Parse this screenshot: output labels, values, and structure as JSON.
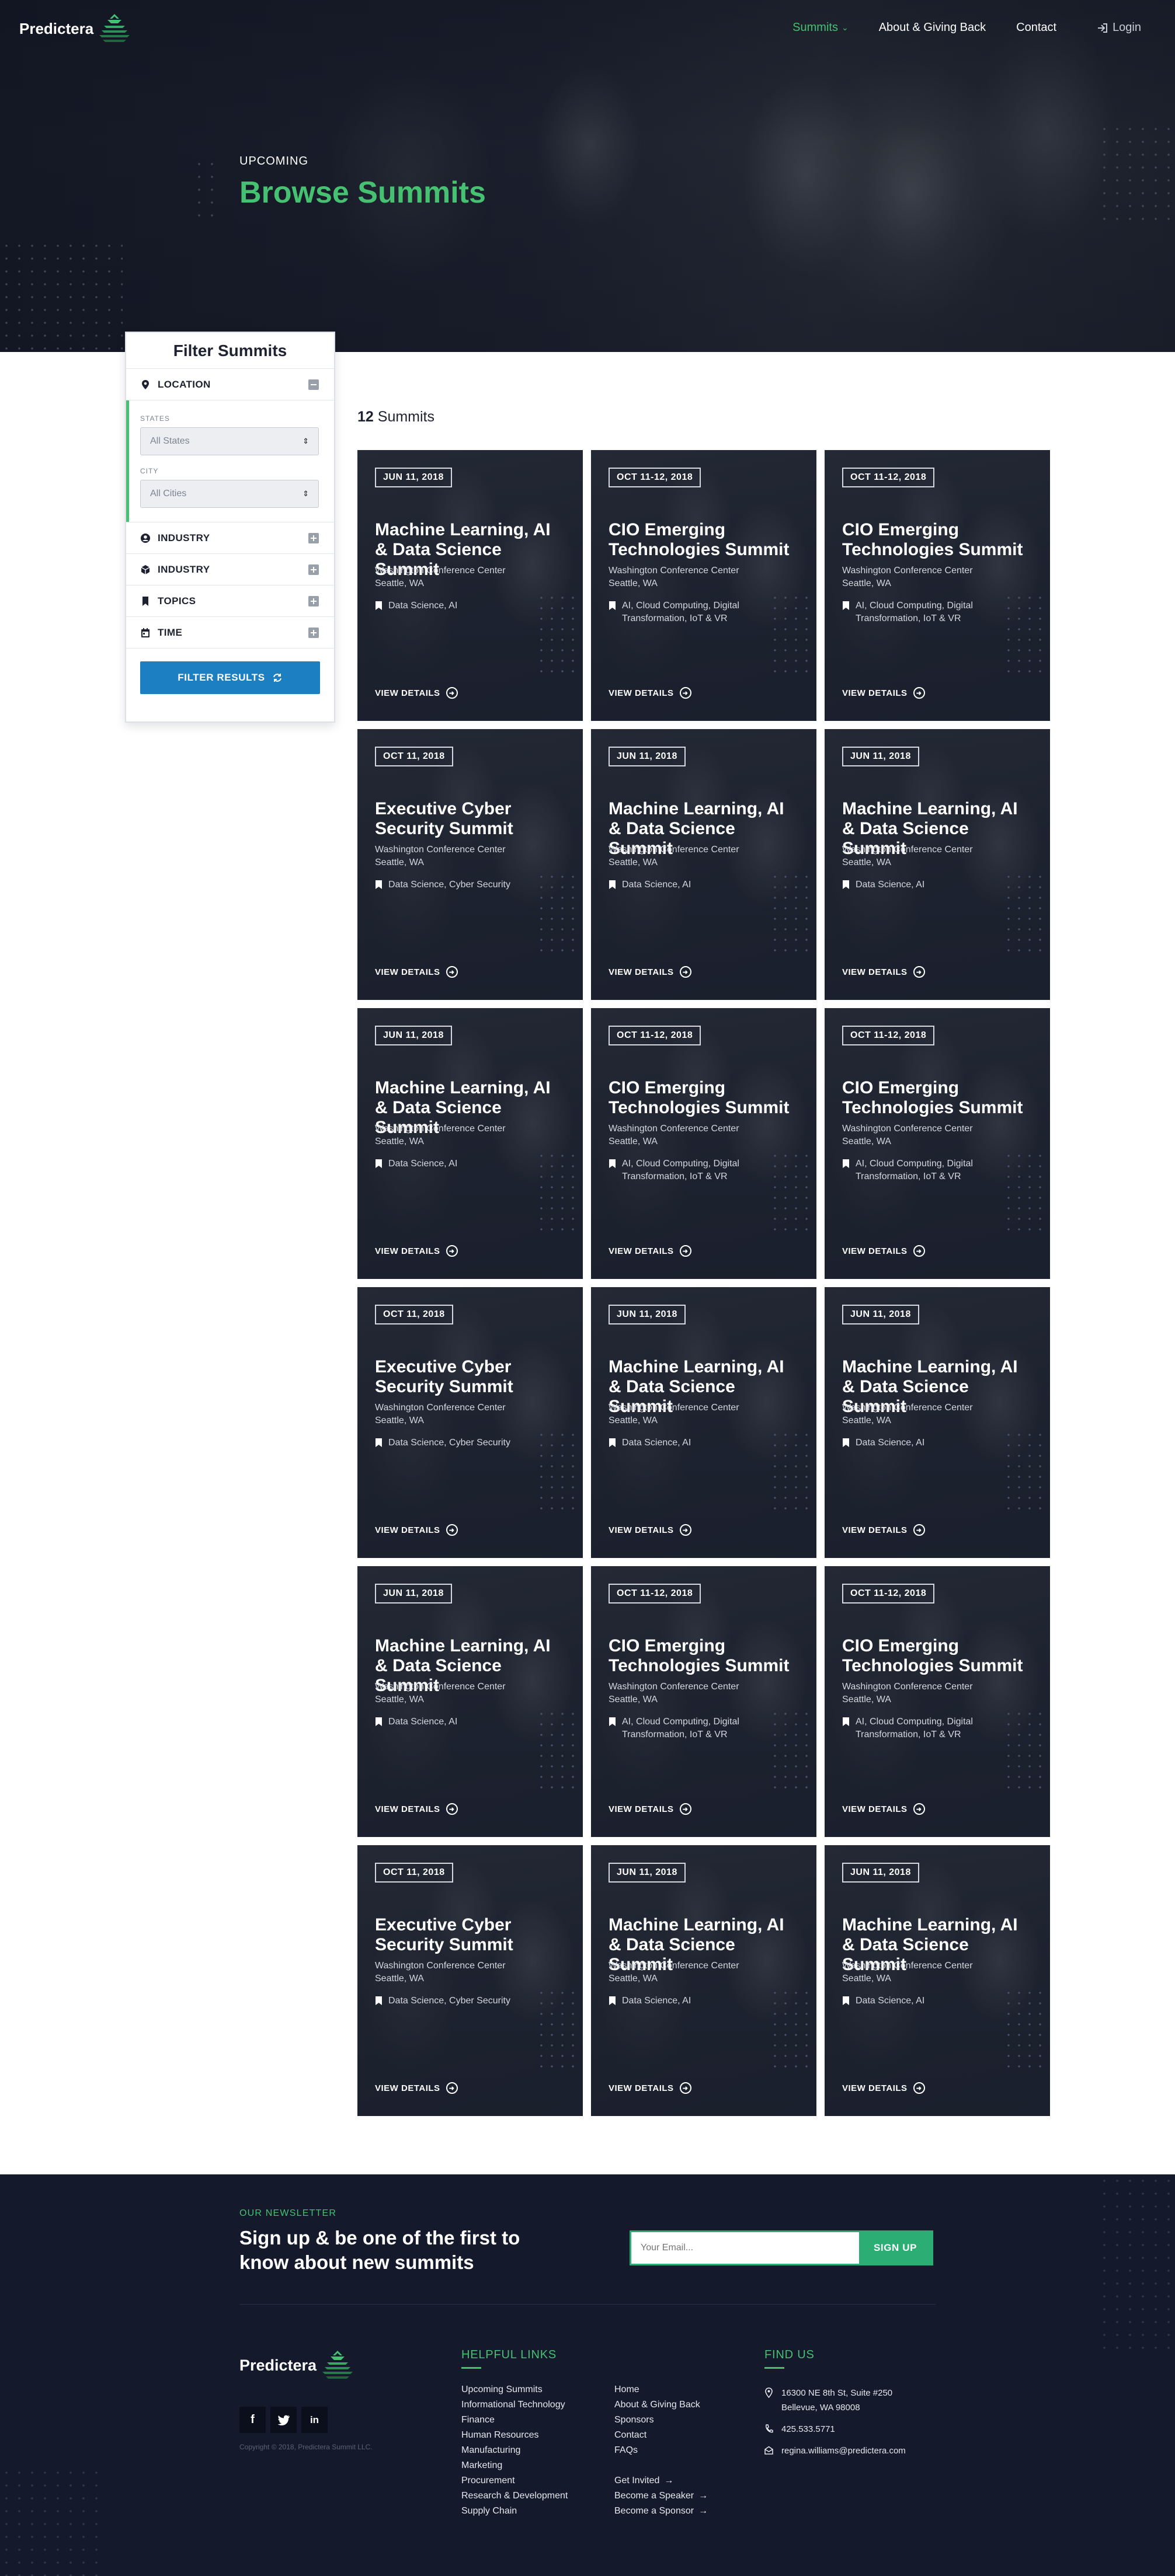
{
  "brand": {
    "name": "Predictera",
    "accent": "#45c171",
    "dark": "#1a1e2b"
  },
  "nav": {
    "items": [
      {
        "label": "Summits",
        "active": true,
        "icon": "chevron-down-icon"
      },
      {
        "label": "About & Giving Back"
      },
      {
        "label": "Contact"
      }
    ],
    "login": "Login"
  },
  "hero": {
    "eyebrow": "UPCOMING",
    "title": "Browse Summits"
  },
  "filter": {
    "title": "Filter Summits",
    "location": {
      "label": "LOCATION",
      "states_label": "STATES",
      "states_value": "All States",
      "city_label": "CITY",
      "city_value": "All Cities"
    },
    "sections": [
      {
        "label": "INDUSTRY",
        "icon": "user-circle-icon"
      },
      {
        "label": "INDUSTRY",
        "icon": "cube-icon"
      },
      {
        "label": "TOPICS",
        "icon": "bookmark-icon"
      },
      {
        "label": "TIME",
        "icon": "calendar-icon"
      }
    ],
    "button": "FILTER RESULTS"
  },
  "results": {
    "count": "12",
    "label": "Summits"
  },
  "cards": [
    {
      "date": "JUN 11, 2018",
      "title": "Machine Learning, AI & Data Science Summit",
      "venue": "Washington Conference Center",
      "city": "Seattle, WA",
      "tags": "Data Science, AI",
      "cta": "VIEW DETAILS"
    },
    {
      "date": "OCT 11-12, 2018",
      "title": "CIO Emerging Technologies Summit",
      "venue": "Washington Conference Center",
      "city": "Seattle, WA",
      "tags": "AI, Cloud Computing, Digital Transformation, IoT & VR",
      "cta": "VIEW DETAILS"
    },
    {
      "date": "OCT 11-12, 2018",
      "title": "CIO Emerging Technologies Summit",
      "venue": "Washington Conference Center",
      "city": "Seattle, WA",
      "tags": "AI, Cloud Computing, Digital Transformation, IoT & VR",
      "cta": "VIEW DETAILS"
    },
    {
      "date": "OCT 11, 2018",
      "title": "Executive Cyber Security Summit",
      "venue": "Washington Conference Center",
      "city": "Seattle, WA",
      "tags": "Data Science, Cyber Security",
      "cta": "VIEW DETAILS"
    },
    {
      "date": "JUN 11, 2018",
      "title": "Machine Learning, AI & Data Science Summit",
      "venue": "Washington Conference Center",
      "city": "Seattle, WA",
      "tags": "Data Science, AI",
      "cta": "VIEW DETAILS"
    },
    {
      "date": "JUN 11, 2018",
      "title": "Machine Learning, AI & Data Science Summit",
      "venue": "Washington Conference Center",
      "city": "Seattle, WA",
      "tags": "Data Science, AI",
      "cta": "VIEW DETAILS"
    },
    {
      "date": "JUN 11, 2018",
      "title": "Machine Learning, AI & Data Science Summit",
      "venue": "Washington Conference Center",
      "city": "Seattle, WA",
      "tags": "Data Science, AI",
      "cta": "VIEW DETAILS"
    },
    {
      "date": "OCT 11-12, 2018",
      "title": "CIO Emerging Technologies Summit",
      "venue": "Washington Conference Center",
      "city": "Seattle, WA",
      "tags": "AI, Cloud Computing, Digital Transformation, IoT & VR",
      "cta": "VIEW DETAILS"
    },
    {
      "date": "OCT 11-12, 2018",
      "title": "CIO Emerging Technologies Summit",
      "venue": "Washington Conference Center",
      "city": "Seattle, WA",
      "tags": "AI, Cloud Computing, Digital Transformation, IoT & VR",
      "cta": "VIEW DETAILS"
    },
    {
      "date": "OCT 11, 2018",
      "title": "Executive Cyber Security Summit",
      "venue": "Washington Conference Center",
      "city": "Seattle, WA",
      "tags": "Data Science, Cyber Security",
      "cta": "VIEW DETAILS"
    },
    {
      "date": "JUN 11, 2018",
      "title": "Machine Learning, AI & Data Science Summit",
      "venue": "Washington Conference Center",
      "city": "Seattle, WA",
      "tags": "Data Science, AI",
      "cta": "VIEW DETAILS"
    },
    {
      "date": "JUN 11, 2018",
      "title": "Machine Learning, AI & Data Science Summit",
      "venue": "Washington Conference Center",
      "city": "Seattle, WA",
      "tags": "Data Science, AI",
      "cta": "VIEW DETAILS"
    },
    {
      "date": "JUN 11, 2018",
      "title": "Machine Learning, AI & Data Science Summit",
      "venue": "Washington Conference Center",
      "city": "Seattle, WA",
      "tags": "Data Science, AI",
      "cta": "VIEW DETAILS"
    },
    {
      "date": "OCT 11-12, 2018",
      "title": "CIO Emerging Technologies Summit",
      "venue": "Washington Conference Center",
      "city": "Seattle, WA",
      "tags": "AI, Cloud Computing, Digital Transformation, IoT & VR",
      "cta": "VIEW DETAILS"
    },
    {
      "date": "OCT 11-12, 2018",
      "title": "CIO Emerging Technologies Summit",
      "venue": "Washington Conference Center",
      "city": "Seattle, WA",
      "tags": "AI, Cloud Computing, Digital Transformation, IoT & VR",
      "cta": "VIEW DETAILS"
    },
    {
      "date": "OCT 11, 2018",
      "title": "Executive Cyber Security Summit",
      "venue": "Washington Conference Center",
      "city": "Seattle, WA",
      "tags": "Data Science, Cyber Security",
      "cta": "VIEW DETAILS"
    },
    {
      "date": "JUN 11, 2018",
      "title": "Machine Learning, AI & Data Science Summit",
      "venue": "Washington Conference Center",
      "city": "Seattle, WA",
      "tags": "Data Science, AI",
      "cta": "VIEW DETAILS"
    },
    {
      "date": "JUN 11, 2018",
      "title": "Machine Learning, AI & Data Science Summit",
      "venue": "Washington Conference Center",
      "city": "Seattle, WA",
      "tags": "Data Science, AI",
      "cta": "VIEW DETAILS"
    }
  ],
  "newsletter": {
    "eyebrow": "OUR NEWSLETTER",
    "title": "Sign up & be one of the first to know about new summits",
    "placeholder": "Your Email...",
    "button": "SIGN UP"
  },
  "footer": {
    "copyright": "Copyright © 2018, Predictera Summit LLC.",
    "social": [
      {
        "label": "f",
        "icon": "facebook-icon"
      },
      {
        "label": "t",
        "icon": "twitter-icon"
      },
      {
        "label": "in",
        "icon": "linkedin-icon"
      }
    ],
    "helpful_title": "HELPFUL LINKS",
    "links_col1": [
      "Upcoming Summits",
      "Informational Technology",
      "Finance",
      "Human Resources",
      "Manufacturing",
      "Marketing",
      "Procurement",
      "Research & Development",
      "Supply Chain"
    ],
    "links_col2": [
      "Home",
      "About & Giving Back",
      "Sponsors",
      "Contact",
      "FAQs"
    ],
    "links_col2_cta": [
      "Get Invited",
      "Become a Speaker",
      "Become a Sponsor"
    ],
    "find_title": "FIND US",
    "address_line1": "16300 NE 8th St, Suite #250",
    "address_line2": "Bellevue, WA 98008",
    "phone": "425.533.5771",
    "email": "regina.williams@predictera.com"
  }
}
